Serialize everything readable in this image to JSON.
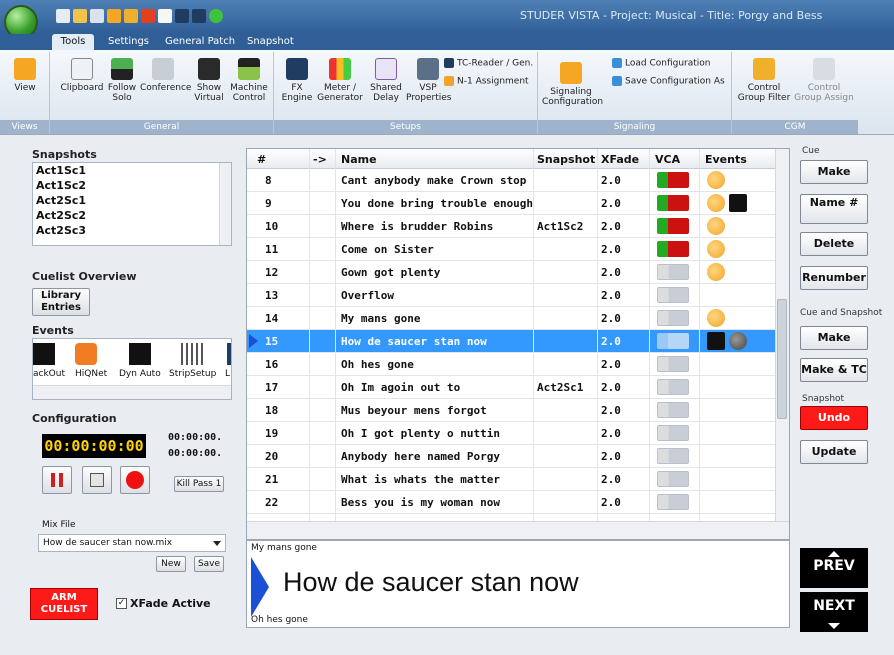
{
  "app": {
    "title": "STUDER VISTA - Project: Musical - Title: Porgy and Bess"
  },
  "ribbon": {
    "tabs": [
      "Tools",
      "Settings",
      "General Patch",
      "Snapshot"
    ],
    "groups": {
      "views": {
        "label": "Views",
        "buttons": [
          "View"
        ]
      },
      "general": {
        "label": "General",
        "buttons": [
          "Clipboard",
          "Follow Solo",
          "Conference",
          "Show Virtual",
          "Machine Control"
        ]
      },
      "setups": {
        "label": "Setups",
        "buttons": [
          "FX Engine",
          "Meter / Generator",
          "Shared Delay",
          "VSP Properties"
        ],
        "small": [
          "TC-Reader / Gen.",
          "N-1 Assignment"
        ]
      },
      "signaling": {
        "label": "Signaling",
        "buttons": [
          "Signaling Configuration"
        ],
        "small": [
          "Load Configuration",
          "Save Configuration As"
        ]
      },
      "cgm": {
        "label": "CGM",
        "buttons": [
          "Control Group Filter",
          "Control Group Assign"
        ]
      }
    }
  },
  "snapshots": {
    "heading": "Snapshots",
    "items": [
      "Act1Sc1",
      "Act1Sc2",
      "Act2Sc1",
      "Act2Sc2",
      "Act2Sc3"
    ]
  },
  "cuelist_overview": {
    "heading": "Cuelist Overview",
    "library_button": "Library Entries"
  },
  "events_panel": {
    "heading": "Events",
    "items": [
      "ackOut",
      "HiQNet",
      "Dyn Auto",
      "StripSetup",
      "L"
    ]
  },
  "configuration": {
    "heading": "Configuration",
    "timecode": "00:00:00:00",
    "tc_right_top": "00:00:00.",
    "tc_right_bottom": "00:00:00.",
    "kill_pass": "Kill Pass 1",
    "mix_file_label": "Mix File",
    "mix_file_value": "How de saucer stan now.mix",
    "new_button": "New",
    "save_button": "Save"
  },
  "arm": {
    "button": "ARM CUELIST",
    "xfade_label": "XFade Active",
    "xfade_checked": true
  },
  "table": {
    "columns": [
      "#",
      "->",
      "Name",
      "Snapshot",
      "XFade",
      "VCA",
      "Events"
    ],
    "rows": [
      {
        "num": "8",
        "name": "Cant anybody make Crown stop",
        "snapshot": "",
        "xfade": "2.0",
        "vca": "on",
        "events": [
          "mask"
        ]
      },
      {
        "num": "9",
        "name": "You done bring trouble enough",
        "snapshot": "",
        "xfade": "2.0",
        "vca": "on",
        "events": [
          "mask",
          "auto"
        ]
      },
      {
        "num": "10",
        "name": "Where is brudder Robins",
        "snapshot": "Act1Sc2",
        "xfade": "2.0",
        "vca": "on",
        "events": [
          "mask"
        ]
      },
      {
        "num": "11",
        "name": "Come on Sister",
        "snapshot": "",
        "xfade": "2.0",
        "vca": "on",
        "events": [
          "mask"
        ]
      },
      {
        "num": "12",
        "name": "Gown got plenty",
        "snapshot": "",
        "xfade": "2.0",
        "vca": "off",
        "events": [
          "mask"
        ]
      },
      {
        "num": "13",
        "name": "Overflow",
        "snapshot": "",
        "xfade": "2.0",
        "vca": "off",
        "events": []
      },
      {
        "num": "14",
        "name": "My mans gone",
        "snapshot": "",
        "xfade": "2.0",
        "vca": "off",
        "events": [
          "mask"
        ]
      },
      {
        "num": "15",
        "name": "How de saucer stan now",
        "snapshot": "",
        "xfade": "2.0",
        "vca": "sel",
        "events": [
          "auto",
          "dot"
        ],
        "selected": true
      },
      {
        "num": "16",
        "name": "Oh hes gone",
        "snapshot": "",
        "xfade": "2.0",
        "vca": "off",
        "events": []
      },
      {
        "num": "17",
        "name": "Oh Im agoin out to",
        "snapshot": "Act2Sc1",
        "xfade": "2.0",
        "vca": "off",
        "events": []
      },
      {
        "num": "18",
        "name": "Mus beyour mens forgot",
        "snapshot": "",
        "xfade": "2.0",
        "vca": "off",
        "events": []
      },
      {
        "num": "19",
        "name": "Oh I got plenty o nuttin",
        "snapshot": "",
        "xfade": "2.0",
        "vca": "off",
        "events": []
      },
      {
        "num": "20",
        "name": "Anybody here named Porgy",
        "snapshot": "",
        "xfade": "2.0",
        "vca": "off",
        "events": []
      },
      {
        "num": "21",
        "name": "What is whats the matter",
        "snapshot": "",
        "xfade": "2.0",
        "vca": "off",
        "events": []
      },
      {
        "num": "22",
        "name": "Bess you is my woman now",
        "snapshot": "",
        "xfade": "2.0",
        "vca": "off",
        "events": []
      }
    ]
  },
  "display": {
    "previous": "My mans gone",
    "current": "How de saucer stan now",
    "next": "Oh hes gone"
  },
  "right_panel": {
    "cue_label": "Cue",
    "make": "Make",
    "name_num": "Name #",
    "delete": "Delete",
    "renumber": "Renumber",
    "cue_snapshot_label": "Cue and Snapshot",
    "make2": "Make",
    "make_tc": "Make & TC",
    "snapshot_label": "Snapshot",
    "undo": "Undo",
    "update": "Update",
    "prev": "PREV",
    "next": "NEXT"
  },
  "colors": {
    "accent_blue": "#3399ff",
    "arm_red": "#ff1a1a",
    "timecode_yellow": "#ffd400",
    "ribbon_blue": "#2f5f96"
  }
}
